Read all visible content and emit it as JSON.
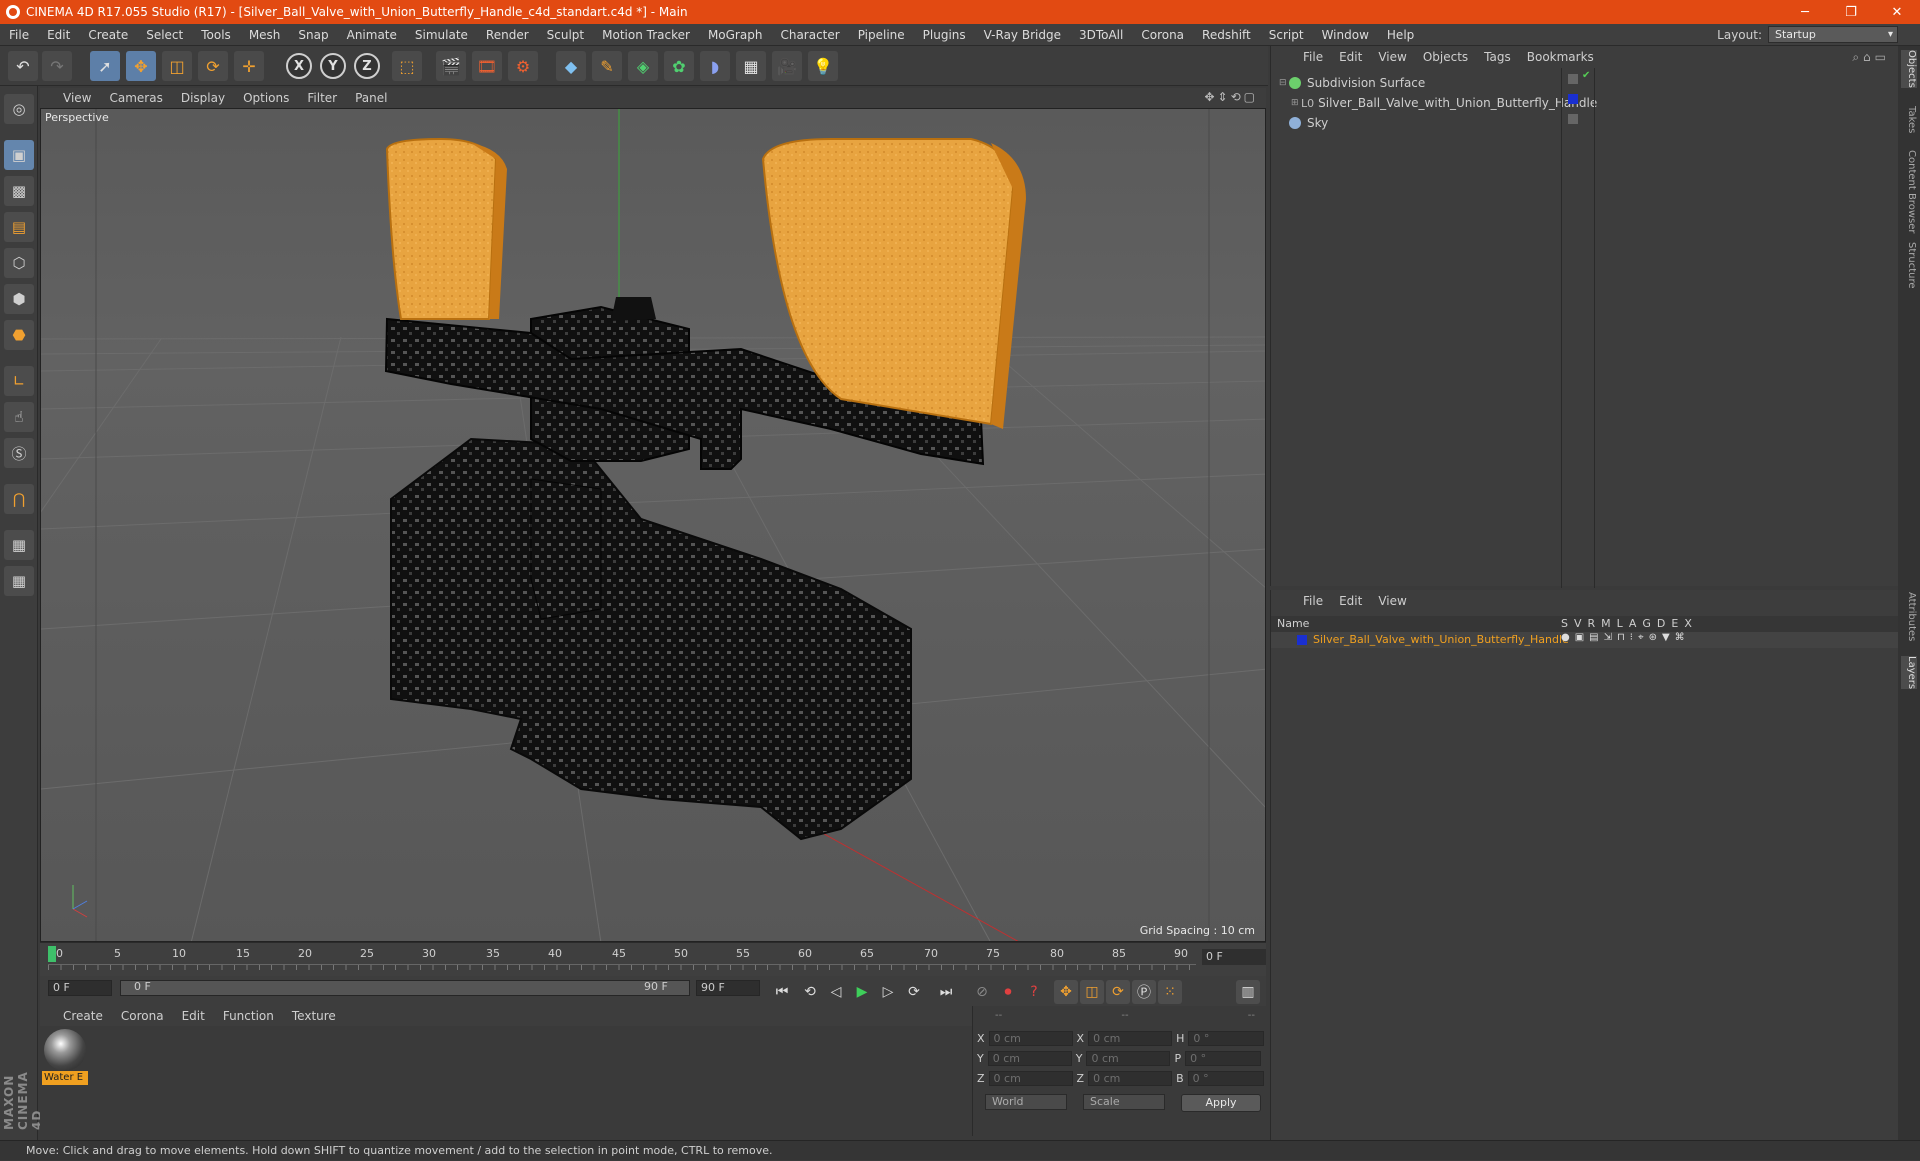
{
  "window": {
    "title": "CINEMA 4D R17.055 Studio (R17) - [Silver_Ball_Valve_with_Union_Butterfly_Handle_c4d_standart.c4d *] - Main",
    "minimize": "─",
    "restore": "❐",
    "close": "✕"
  },
  "menu": [
    "File",
    "Edit",
    "Create",
    "Select",
    "Tools",
    "Mesh",
    "Snap",
    "Animate",
    "Simulate",
    "Render",
    "Sculpt",
    "Motion Tracker",
    "MoGraph",
    "Character",
    "Pipeline",
    "Plugins",
    "V-Ray Bridge",
    "3DToAll",
    "Corona",
    "Redshift",
    "Script",
    "Window",
    "Help"
  ],
  "layout": {
    "label": "Layout:",
    "value": "Startup"
  },
  "toolbar": {
    "axis_x": "X",
    "axis_y": "Y",
    "axis_z": "Z"
  },
  "viewport": {
    "menu": [
      "View",
      "Cameras",
      "Display",
      "Options",
      "Filter",
      "Panel"
    ],
    "label": "Perspective",
    "grid_spacing": "Grid Spacing : 10 cm",
    "nav_icons": "✥⇕⟲▢"
  },
  "timeline": {
    "ticks": [
      "0",
      "5",
      "10",
      "15",
      "20",
      "25",
      "30",
      "35",
      "40",
      "45",
      "50",
      "55",
      "60",
      "65",
      "70",
      "75",
      "80",
      "85",
      "90"
    ],
    "current_frame": "0 F",
    "start_field": "0 F",
    "range_start": "0 F",
    "range_end": "90 F",
    "end_field": "90 F"
  },
  "material_manager": {
    "menu": [
      "Create",
      "Corona",
      "Edit",
      "Function",
      "Texture"
    ],
    "materials": [
      {
        "name": "Water E"
      }
    ]
  },
  "coordinates": {
    "header": [
      "--",
      "--",
      "--"
    ],
    "rows": [
      {
        "a": "X",
        "av": "0 cm",
        "b": "X",
        "bv": "0 cm",
        "c": "H",
        "cv": "0 °"
      },
      {
        "a": "Y",
        "av": "0 cm",
        "b": "Y",
        "bv": "0 cm",
        "c": "P",
        "cv": "0 °"
      },
      {
        "a": "Z",
        "av": "0 cm",
        "b": "Z",
        "bv": "0 cm",
        "c": "B",
        "cv": "0 °"
      }
    ],
    "mode": "World",
    "scale": "Scale",
    "apply": "Apply"
  },
  "object_manager": {
    "menu": [
      "File",
      "Edit",
      "View",
      "Objects",
      "Tags",
      "Bookmarks"
    ],
    "objects": [
      {
        "name": "Subdivision Surface",
        "color": "#6ccf6c"
      },
      {
        "name": "Silver_Ball_Valve_with_Union_Butterfly_Handle",
        "color": "#9a9a9a"
      },
      {
        "name": "Sky",
        "color": "#8fb0d8"
      }
    ]
  },
  "layer_manager": {
    "menu": [
      "File",
      "Edit",
      "View"
    ],
    "header_name": "Name",
    "columns": [
      "S",
      "V",
      "R",
      "M",
      "L",
      "A",
      "G",
      "D",
      "E",
      "X"
    ],
    "layers": [
      {
        "name": "Silver_Ball_Valve_with_Union_Butterfly_Handle",
        "color": "#1a2fd0"
      }
    ]
  },
  "side_tabs": [
    "Objects",
    "Takes",
    "Content Browser",
    "Structure",
    "Attributes",
    "Layers"
  ],
  "status": "Move: Click and drag to move elements. Hold down SHIFT to quantize movement / add to the selection in point mode, CTRL to remove.",
  "brand": "MAXON CINEMA 4D",
  "colors": {
    "accent": "#e24a12",
    "selection": "#f0a020",
    "active_tool": "#5d7fa8"
  }
}
